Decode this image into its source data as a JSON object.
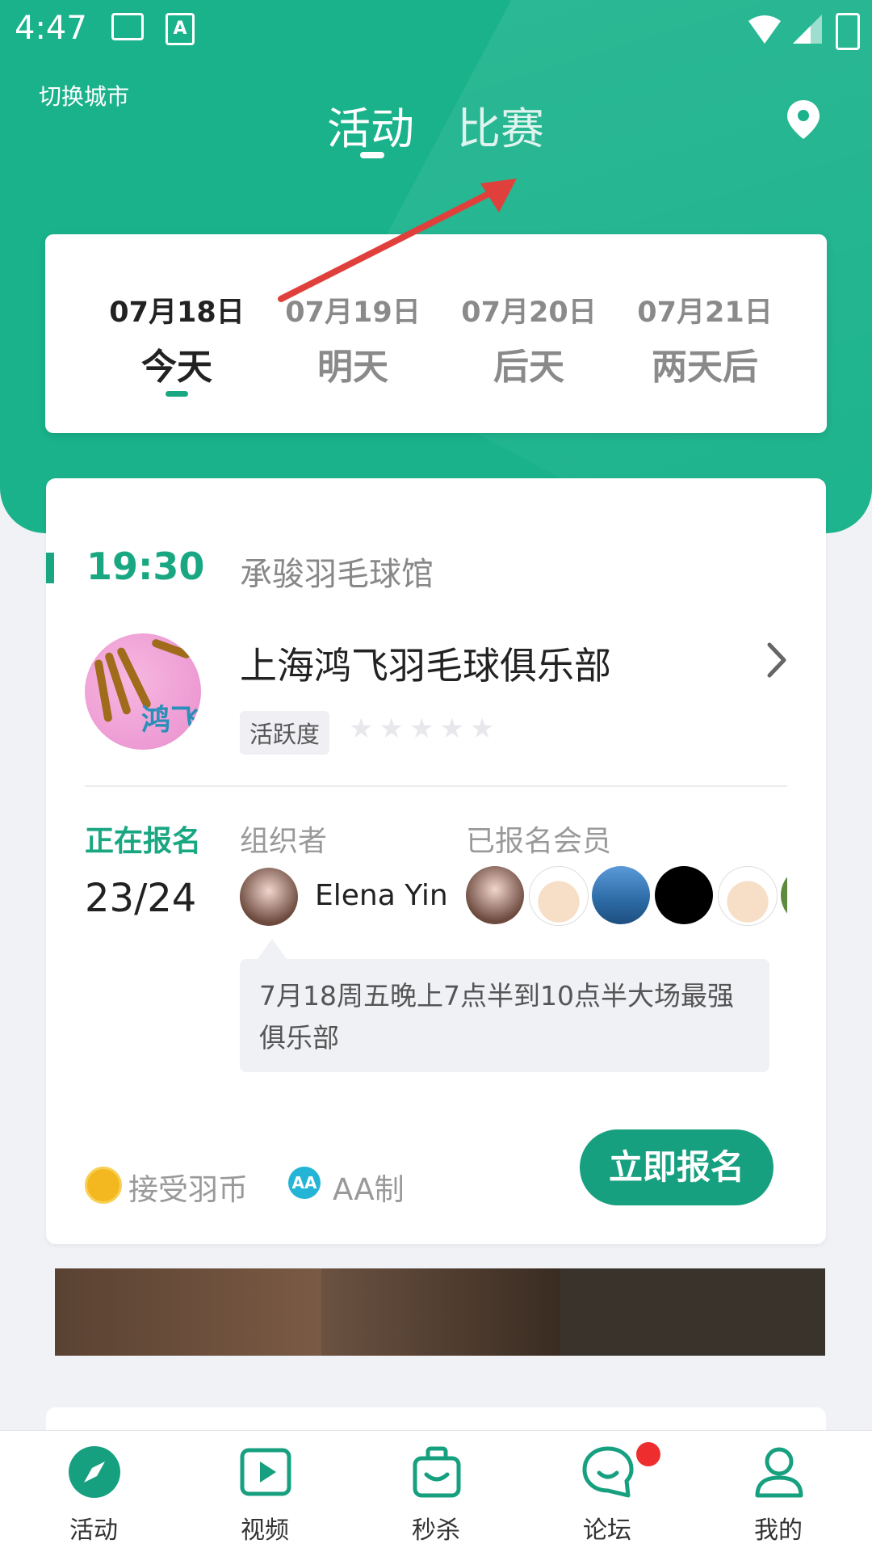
{
  "status_bar": {
    "time": "4:47"
  },
  "header": {
    "switch_city": "切换城市",
    "tabs": [
      {
        "label": "活动",
        "active": true
      },
      {
        "label": "比赛",
        "active": false
      }
    ],
    "location_icon": "map-pin-icon"
  },
  "dates": [
    {
      "date": "07月18日",
      "day": "今天",
      "selected": true
    },
    {
      "date": "07月19日",
      "day": "明天",
      "selected": false
    },
    {
      "date": "07月20日",
      "day": "后天",
      "selected": false
    },
    {
      "date": "07月21日",
      "day": "两天后",
      "selected": false
    }
  ],
  "activity": {
    "time": "19:30",
    "venue": "承骏羽毛球馆",
    "club_name": "上海鸿飞羽毛球俱乐部",
    "club_logo_text": "鸿飞",
    "activity_badge": "活跃度",
    "rating_stars": 0,
    "rating_max": 5,
    "registration_status": "正在报名",
    "registration_count": "23/24",
    "organizer_label": "组织者",
    "organizer_name": "Elena Yin",
    "members_label": "已报名会员",
    "note": "7月18周五晚上7点半到10点半大场最强俱乐部",
    "coin_label": "接受羽币",
    "aa_icon_text": "AA",
    "aa_label": "AA制",
    "signup_button": "立即报名"
  },
  "colors": {
    "brand": "#19b28b",
    "accent": "#17a07f",
    "notification": "#ee2e2e"
  },
  "bottom_nav": [
    {
      "label": "活动",
      "icon": "compass-icon",
      "active": true
    },
    {
      "label": "视频",
      "icon": "play-icon",
      "active": false
    },
    {
      "label": "秒杀",
      "icon": "shopping-bag-icon",
      "active": false
    },
    {
      "label": "论坛",
      "icon": "chat-bubble-icon",
      "active": false,
      "has_notification": true
    },
    {
      "label": "我的",
      "icon": "user-icon",
      "active": false
    }
  ]
}
